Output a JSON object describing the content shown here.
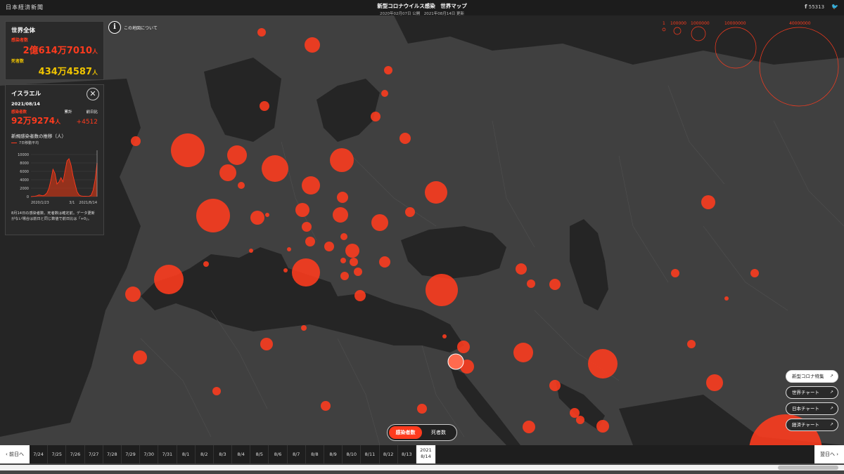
{
  "header": {
    "logo": "日本経済新聞",
    "title": "新型コロナウイルス感染　世界マップ",
    "subtitle": "2020年02月07日 公開　2021年08月14日 更新",
    "share_count": "55313"
  },
  "about": {
    "label": "この地図について"
  },
  "world": {
    "title": "世界全体",
    "cases_label": "感染者数",
    "cases_value": "2億614万7010",
    "cases_unit": "人",
    "deaths_label": "死者数",
    "deaths_value": "434万4587",
    "deaths_unit": "人"
  },
  "country": {
    "name": "イスラエル",
    "date": "2021/08/14",
    "cases_label": "感染者数",
    "cumulative_label": "累計",
    "daily_label": "前日比",
    "cases_value": "92万9274",
    "cases_unit": "人",
    "daily_value": "+4512",
    "chart_title": "新規感染者数の推移（人）",
    "legend": "7日移動平均",
    "note": "8月14日の感染者数、死者数は確定前。データ更新がない場合は前日と同じ数値で前日比は「+0」。"
  },
  "chart_data": {
    "type": "area",
    "title": "新規感染者数の推移（人）",
    "series": [
      {
        "name": "7日移動平均",
        "values": [
          0,
          50,
          100,
          200,
          400,
          300,
          200,
          400,
          900,
          2000,
          4000,
          6500,
          5500,
          3000,
          3500,
          4500,
          3500,
          6000,
          8500,
          9000,
          7500,
          5000,
          3000,
          1200,
          400,
          150,
          100,
          80,
          60,
          100,
          300,
          1500,
          4000,
          8000
        ]
      }
    ],
    "x_ticks": [
      "2020/1/23",
      "3/1",
      "2021/8/14"
    ],
    "y_ticks": [
      0,
      2000,
      4000,
      6000,
      8000,
      10000
    ],
    "ylim": [
      0,
      11000
    ]
  },
  "scale": {
    "labels": [
      "1",
      "100000",
      "1000000",
      "10000000",
      "40000000"
    ]
  },
  "mode": {
    "cases": "感染者数",
    "deaths": "死者数"
  },
  "links": [
    {
      "label": "新型コロナ特集"
    },
    {
      "label": "世界チャート"
    },
    {
      "label": "日本チャート"
    },
    {
      "label": "経済チャート"
    }
  ],
  "timeline": {
    "prev": "前日へ",
    "next": "翌日へ",
    "days": [
      "7/24",
      "7/25",
      "7/26",
      "7/27",
      "7/28",
      "7/29",
      "7/30",
      "7/31",
      "8/1",
      "8/2",
      "8/3",
      "8/4",
      "8/5",
      "8/6",
      "8/7",
      "8/8",
      "8/9",
      "8/10",
      "8/11",
      "8/12",
      "8/13"
    ],
    "current_year": "2021",
    "current_day": "8/14"
  },
  "colors": {
    "accent": "#ff3b1e",
    "deaths": "#f0c400",
    "land": "#3e3e3e",
    "sea": "#252525"
  }
}
